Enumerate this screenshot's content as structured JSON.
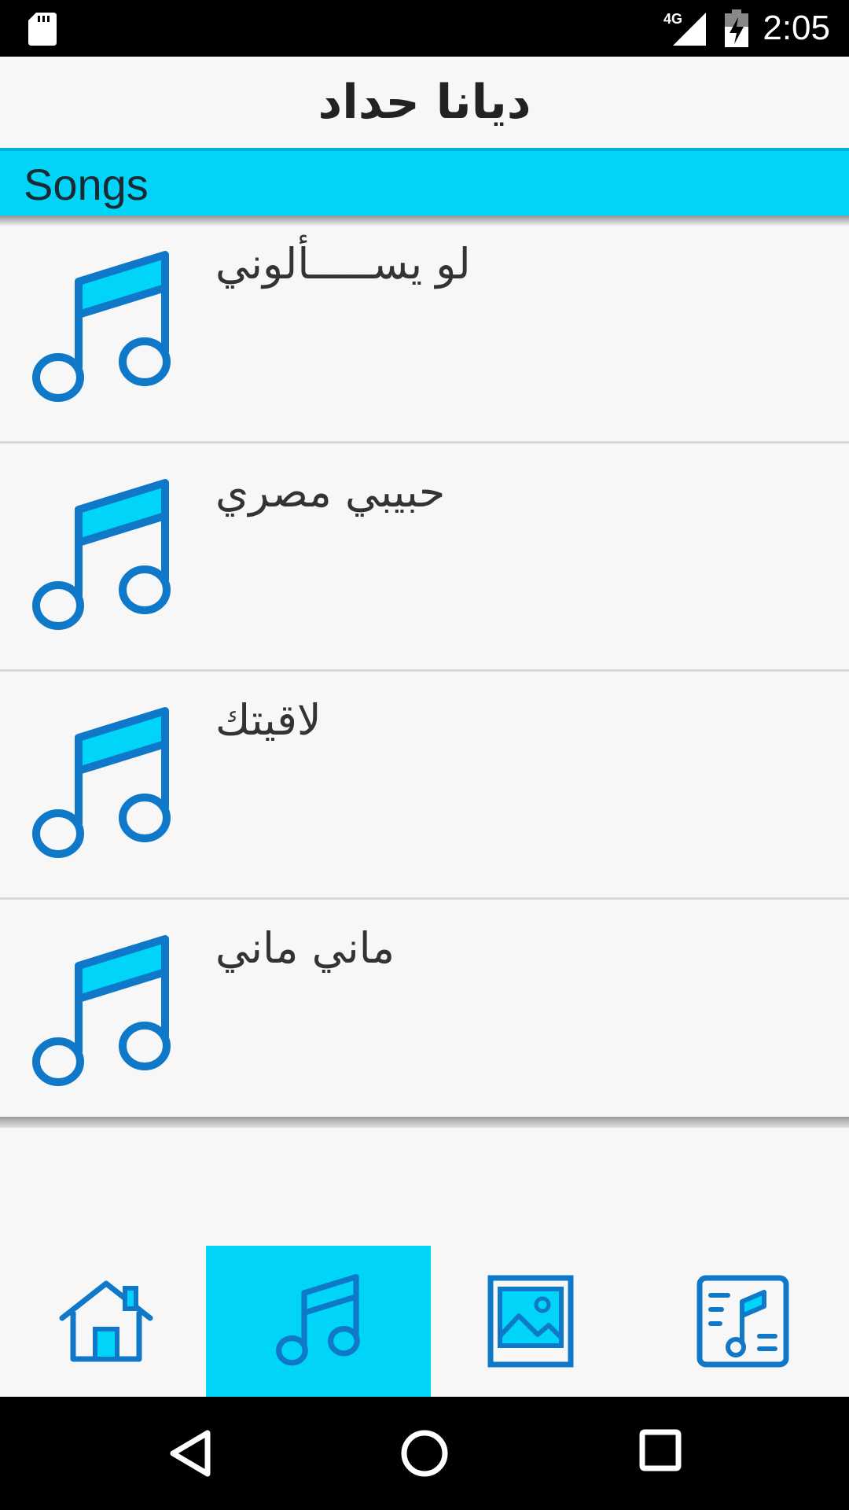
{
  "status_bar": {
    "time": "2:05",
    "network": "4G",
    "icons": [
      "sd-card-icon",
      "signal-icon",
      "battery-charging-icon"
    ]
  },
  "header": {
    "title": "ديانا حداد"
  },
  "section": {
    "label": "Songs"
  },
  "songs": [
    {
      "title": "لو يســـــألوني",
      "icon": "music-note-icon"
    },
    {
      "title": "حبيبي مصري",
      "icon": "music-note-icon"
    },
    {
      "title": "لاقيتك",
      "icon": "music-note-icon"
    },
    {
      "title": "ماني ماني",
      "icon": "music-note-icon"
    }
  ],
  "bottom_nav": {
    "tabs": [
      {
        "icon": "home-icon",
        "active": false
      },
      {
        "icon": "music-note-icon",
        "active": true
      },
      {
        "icon": "image-icon",
        "active": false
      },
      {
        "icon": "playlist-icon",
        "active": false
      }
    ]
  },
  "colors": {
    "accent": "#00d4f8",
    "icon_blue": "#0f78c8",
    "background": "#f7f7f8"
  }
}
